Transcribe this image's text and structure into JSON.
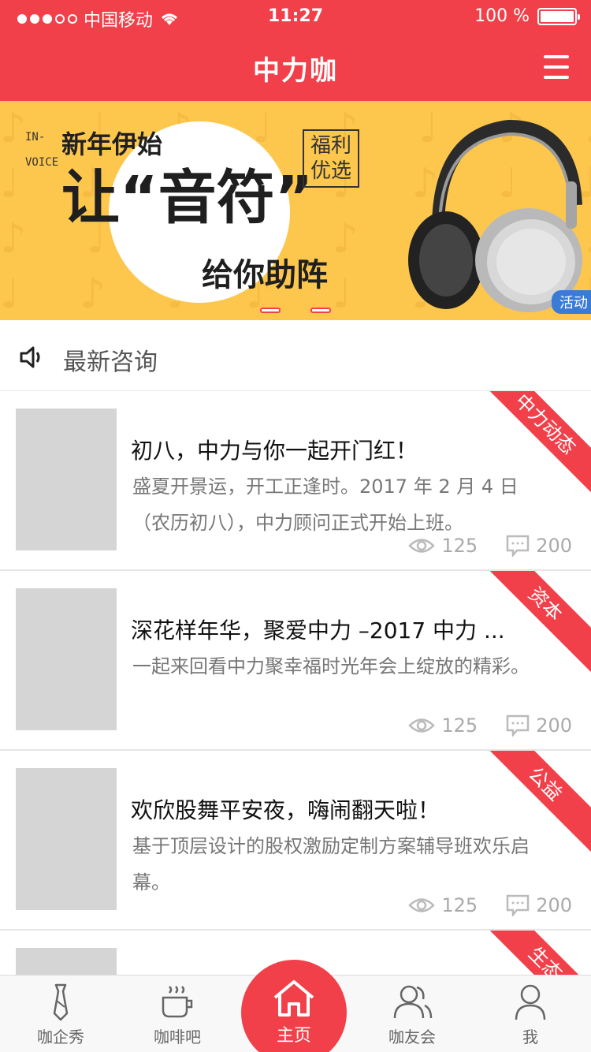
{
  "status_bar": {
    "carrier": "中国移动",
    "time": "11:27",
    "battery": "100 %"
  },
  "nav": {
    "title": "中力咖"
  },
  "banner": {
    "vertical_text": "IN-VOICE",
    "line1": "新年伊始",
    "line2": "让“音符”",
    "line3": "给你助阵",
    "badge": "福利优选",
    "tag": "活动",
    "slide_count": 2
  },
  "news_header": {
    "label": "最新咨询"
  },
  "articles": [
    {
      "title": "初八，中力与你一起开门红！",
      "desc": "盛夏开景运，开工正逢时。2017 年 2 月 4 日（农历初八），中力顾问正式开始上班。",
      "views": "125",
      "comments": "200",
      "ribbon": "中力动态"
    },
    {
      "title": "深花样年华，聚爱中力 –2017 中力 ...",
      "desc": "一起来回看中力聚幸福时光年会上绽放的精彩。",
      "views": "125",
      "comments": "200",
      "ribbon": "资本"
    },
    {
      "title": "欢欣股舞平安夜，嗨闹翻天啦！",
      "desc": "基于顶层设计的股权激励定制方案辅导班欢乐启幕。",
      "views": "125",
      "comments": "200",
      "ribbon": "公益"
    },
    {
      "ribbon": "生态"
    }
  ],
  "tabbar": {
    "tabs": [
      {
        "label": "咖企秀",
        "icon": "tie-icon"
      },
      {
        "label": "咖啡吧",
        "icon": "coffee-icon"
      },
      {
        "label": "主页",
        "icon": "home-icon"
      },
      {
        "label": "咖友会",
        "icon": "people-icon"
      },
      {
        "label": "我",
        "icon": "user-icon"
      }
    ]
  },
  "colors": {
    "brand": "#f2404a",
    "banner_bg": "#fdc74e"
  }
}
